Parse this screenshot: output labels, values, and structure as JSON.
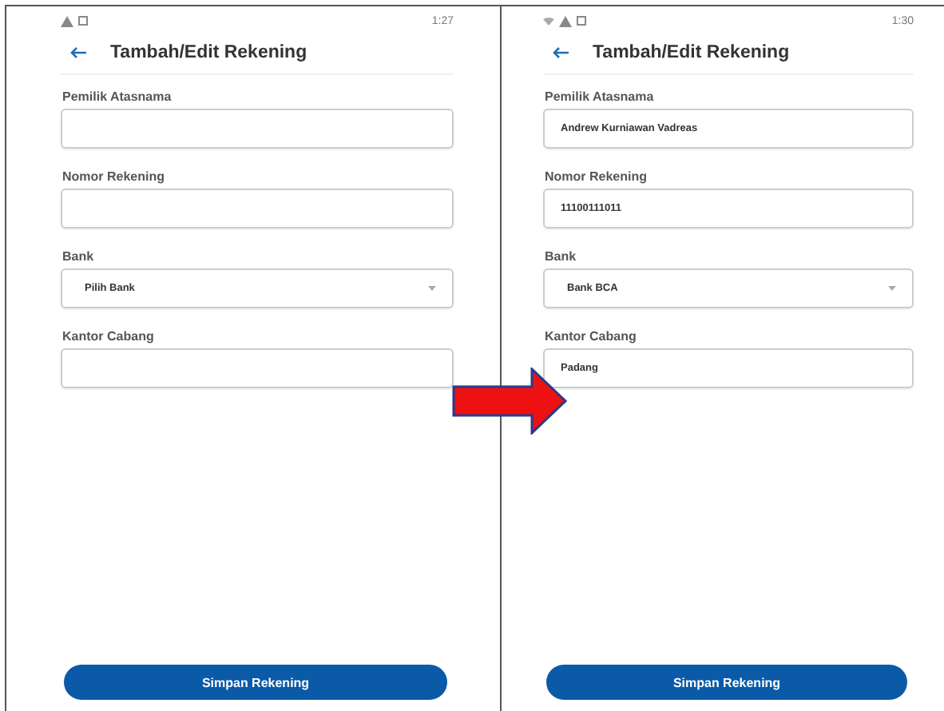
{
  "screens": [
    {
      "status_icons": [
        {
          "kind": "warning"
        },
        {
          "kind": "square"
        }
      ],
      "time": "1:27",
      "title": "Tambah/Edit Rekening",
      "fields": [
        {
          "label": "Pemilik Atasnama",
          "kind": "text"
        },
        {
          "label": "Nomor Rekening",
          "kind": "text"
        },
        {
          "label": "Bank",
          "kind": "select",
          "value": "Pilih Bank"
        },
        {
          "label": "Kantor Cabang",
          "kind": "text"
        }
      ],
      "button": "Simpan Rekening"
    },
    {
      "status_icons": [
        {
          "kind": "wifi"
        },
        {
          "kind": "warning"
        },
        {
          "kind": "square"
        }
      ],
      "time": "1:30",
      "title": "Tambah/Edit Rekening",
      "fields": [
        {
          "label": "Pemilik Atasnama",
          "kind": "text",
          "value": "Andrew Kurniawan Vadreas"
        },
        {
          "label": "Nomor Rekening",
          "kind": "text",
          "value": "11100111011"
        },
        {
          "label": "Bank",
          "kind": "select",
          "value": "Bank BCA"
        },
        {
          "label": "Kantor Cabang",
          "kind": "text",
          "value": "Padang"
        }
      ],
      "button": "Simpan Rekening"
    }
  ]
}
